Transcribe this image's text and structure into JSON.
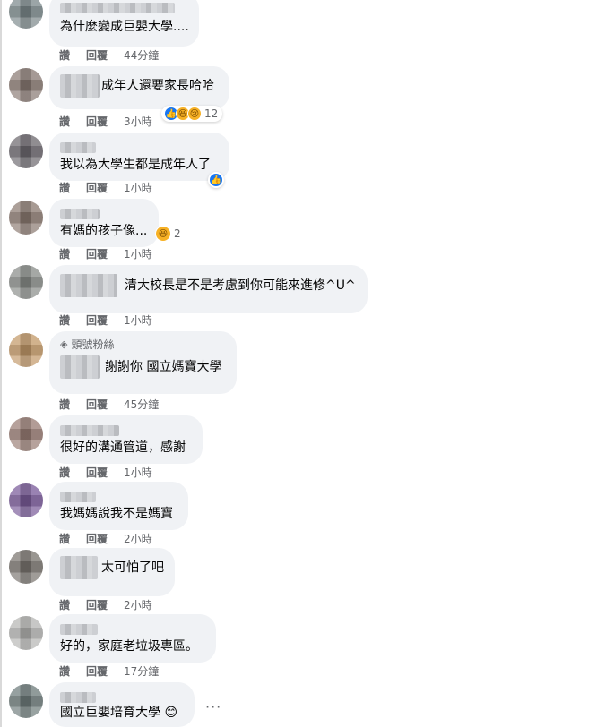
{
  "actions": {
    "like": "讚",
    "reply": "回覆"
  },
  "comments": [
    {
      "text": "為什麼變成巨嬰大學....",
      "time": "44分鐘"
    },
    {
      "text": "成年人還要家長哈哈",
      "time": "3小時",
      "reaction_count": "12",
      "reaction_icons": [
        "like-icon",
        "haha-icon",
        "sad-icon"
      ]
    },
    {
      "text": "我以為大學生都是成年人了",
      "time": "1小時",
      "reaction_icons": [
        "like-icon"
      ]
    },
    {
      "text": "有媽的孩子像...",
      "time": "1小時",
      "reaction_count": "2",
      "reaction_icons": [
        "haha-icon"
      ]
    },
    {
      "text": "清大校長是不是考慮到你可能來進修^U^",
      "time": "1小時"
    },
    {
      "badge": "頭號粉絲",
      "text": "謝謝你 國立媽寶大學",
      "time": "45分鐘"
    },
    {
      "text": "很好的溝通管道，感謝",
      "time": "1小時"
    },
    {
      "text": "我媽媽說我不是媽寶",
      "time": "2小時"
    },
    {
      "text": "太可怕了吧",
      "time": "2小時"
    },
    {
      "text": "好的，家庭老垃圾專區。",
      "time": "17分鐘"
    },
    {
      "text": "國立巨嬰培育大學 😊",
      "more": "···"
    }
  ],
  "colors": {
    "bubble": "#f0f2f5",
    "like": "#1877f2",
    "haha": "#f7b125",
    "meta": "#65676b"
  }
}
